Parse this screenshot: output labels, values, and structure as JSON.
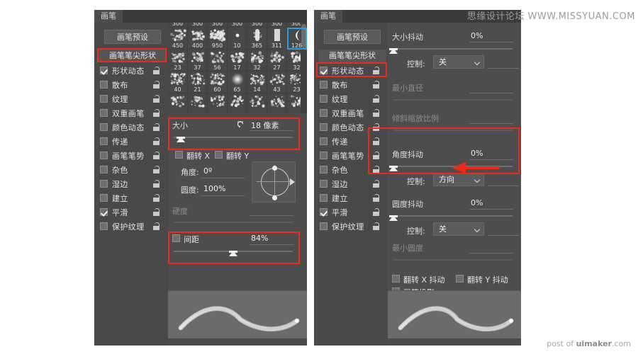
{
  "watermarks": {
    "top": "思缘设计论坛 WWW.MISSYUAN.COM",
    "bottom_pre": "post of ",
    "bottom_brand": "uimaker",
    "bottom_post": ".com"
  },
  "panel_left": {
    "tab_title": "画笔",
    "preset_button": "画笔预设",
    "tip_shape_button": "画笔笔尖形状",
    "options": [
      {
        "label": "形状动态",
        "checked": true
      },
      {
        "label": "散布",
        "checked": false
      },
      {
        "label": "纹理",
        "checked": false
      },
      {
        "label": "双重画笔",
        "checked": false
      },
      {
        "label": "颜色动态",
        "checked": false
      },
      {
        "label": "传递",
        "checked": false
      },
      {
        "label": "画笔笔势",
        "checked": false
      },
      {
        "label": "杂色",
        "checked": false
      },
      {
        "label": "湿边",
        "checked": false
      },
      {
        "label": "建立",
        "checked": false
      },
      {
        "label": "平滑",
        "checked": true
      },
      {
        "label": "保护纹理",
        "checked": false
      }
    ],
    "brush_grid": [
      [
        "450",
        "400",
        "950",
        "10",
        "365",
        "311",
        "126"
      ],
      [
        "23",
        "37",
        "56",
        "17",
        "32",
        "27",
        "32"
      ],
      [
        "40",
        "21",
        "60",
        "65",
        "14",
        "43",
        "23"
      ]
    ],
    "selected_brush": "126",
    "size": {
      "label": "大小",
      "value": "18 像素",
      "reset_icon": "reset-arrow-icon",
      "slider_percent": 6
    },
    "flip_x": {
      "label": "翻转 X",
      "checked": false
    },
    "flip_y": {
      "label": "翻转 Y",
      "checked": false
    },
    "angle": {
      "label": "角度:",
      "value": "0º"
    },
    "roundness": {
      "label": "圆度:",
      "value": "100%"
    },
    "hardness": {
      "label": "硬度",
      "value": "",
      "enabled": false
    },
    "spacing": {
      "label": "间距",
      "value": "84%",
      "checked": true,
      "slider_percent": 50
    }
  },
  "panel_right": {
    "tab_title": "画笔",
    "preset_button": "画笔预设",
    "tip_shape_button": "画笔笔尖形状",
    "options": [
      {
        "label": "形状动态",
        "checked": true
      },
      {
        "label": "散布",
        "checked": false
      },
      {
        "label": "纹理",
        "checked": false
      },
      {
        "label": "双重画笔",
        "checked": false
      },
      {
        "label": "颜色动态",
        "checked": false
      },
      {
        "label": "传递",
        "checked": false
      },
      {
        "label": "画笔笔势",
        "checked": false
      },
      {
        "label": "杂色",
        "checked": false
      },
      {
        "label": "湿边",
        "checked": false
      },
      {
        "label": "建立",
        "checked": false
      },
      {
        "label": "平滑",
        "checked": true
      },
      {
        "label": "保护纹理",
        "checked": false
      }
    ],
    "size_jitter": {
      "label": "大小抖动",
      "value": "0%",
      "slider_percent": 0,
      "control_label": "控制:",
      "control_value": "关"
    },
    "min_diameter": {
      "label": "最小直径",
      "value": "",
      "enabled": false
    },
    "tilt_scale": {
      "label": "倾斜缩放比例",
      "value": "",
      "enabled": false
    },
    "angle_jitter": {
      "label": "角度抖动",
      "value": "0%",
      "slider_percent": 0,
      "control_label": "控制:",
      "control_value": "方向"
    },
    "roundness_jitter": {
      "label": "圆度抖动",
      "value": "0%",
      "slider_percent": 0,
      "control_label": "控制:",
      "control_value": "关"
    },
    "min_roundness": {
      "label": "最小圆度",
      "value": "",
      "enabled": false
    },
    "flip_x_jitter": {
      "label": "翻转 X 抖动",
      "checked": false
    },
    "flip_y_jitter": {
      "label": "翻转 Y 抖动",
      "checked": false
    },
    "brush_projection": {
      "label": "画笔投影",
      "checked": false
    }
  },
  "annotations": {
    "highlight_color": "#ee2b19",
    "arrow": "left-pointing-red-arrow"
  }
}
